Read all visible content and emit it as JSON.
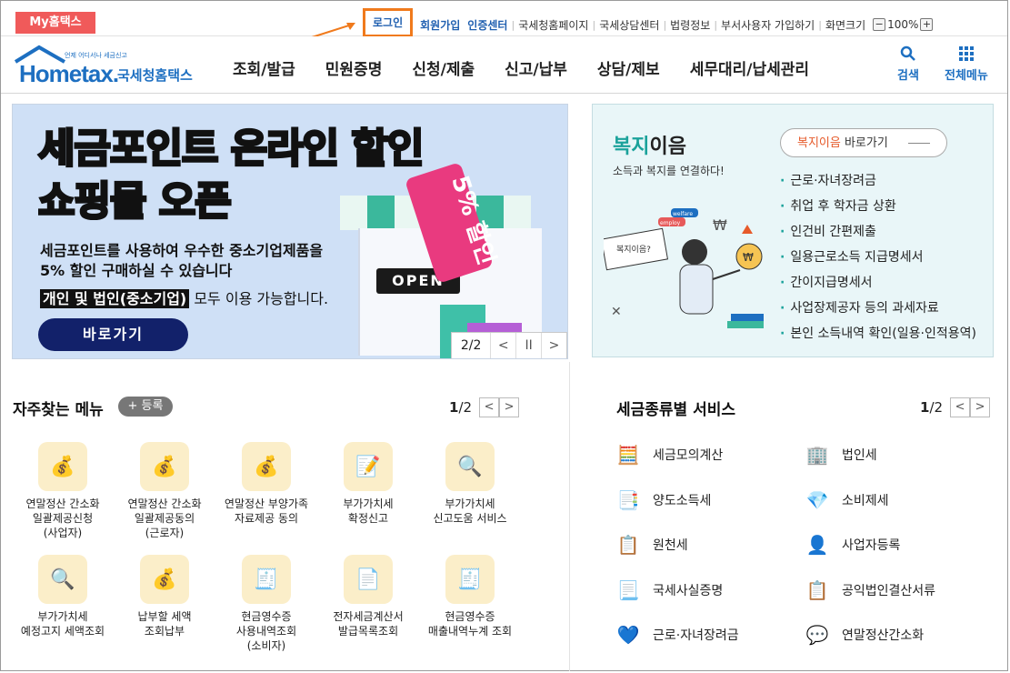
{
  "topbar": {
    "my_hometax": "My홈택스",
    "login": "로그인",
    "signup": "회원가입",
    "cert_center": "인증센터",
    "links": [
      "국세청홈페이지",
      "국세상담센터",
      "법령정보",
      "부서사용자 가입하기"
    ],
    "screen_size_label": "화면크기",
    "zoom_value": "100%",
    "zoom_out": "−",
    "zoom_in": "+"
  },
  "header": {
    "logo_main": "Hometax.",
    "logo_sub": "언제 어디서나 세금신고",
    "logo_kor": "국세청홈택스",
    "nav": [
      "조회/발급",
      "민원증명",
      "신청/제출",
      "신고/납부",
      "상담/제보",
      "세무대리/납세관리"
    ],
    "search_label": "검색",
    "all_menu_label": "전체메뉴"
  },
  "banner": {
    "title1": "세금포인트 온라인 할인",
    "title2": "쇼핑몰 오픈",
    "desc1": "세금포인트를 사용하여 우수한 중소기업제품을",
    "desc2": "5% 할인 구매하실 수 있습니다",
    "desc3_highlight": "개인 및 법인(중소기업)",
    "desc3_rest": " 모두 이용 가능합니다.",
    "button": "바로가기",
    "open_sign": "OPEN",
    "tag_text": "5% 할인",
    "pager": "2/2",
    "prev": "<",
    "pause": "II",
    "next": ">"
  },
  "welfare": {
    "title_green": "복지",
    "title_rest": "이음",
    "subtitle": "소득과 복지를 연결하다!",
    "button_highlight": "복지이음",
    "button_rest": " 바로가기",
    "items": [
      "근로·자녀장려금",
      "취업 후 학자금 상환",
      "인건비 간편제출",
      "일용근로소득 지급명세서",
      "간이지급명세서",
      "사업장제공자 등의 과세자료",
      "본인 소득내역 확인(일용·인적용역)"
    ],
    "illu_bubble": "복지이음?",
    "illu_speech1": "employ",
    "illu_speech2": "welfare"
  },
  "favorites": {
    "title": "자주찾는 메뉴",
    "register": "+ 등록",
    "page_current": "1",
    "page_total": "/2",
    "prev": "<",
    "next": ">",
    "items": [
      {
        "label1": "연말정산 간소화",
        "label2": "일괄제공신청",
        "label3": "(사업자)",
        "icon": "money-bag-icon"
      },
      {
        "label1": "연말정산 간소화",
        "label2": "일괄제공동의",
        "label3": "(근로자)",
        "icon": "money-bag-icon"
      },
      {
        "label1": "연말정산 부양가족",
        "label2": "자료제공 동의",
        "label3": "",
        "icon": "money-bag-icon"
      },
      {
        "label1": "부가가치세",
        "label2": "확정신고",
        "label3": "",
        "icon": "vat-icon"
      },
      {
        "label1": "부가가치세",
        "label2": "신고도움 서비스",
        "label3": "",
        "icon": "document-search-icon"
      },
      {
        "label1": "부가가치세",
        "label2": "예정고지 세액조회",
        "label3": "",
        "icon": "document-search-icon"
      },
      {
        "label1": "납부할 세액",
        "label2": "조회납부",
        "label3": "",
        "icon": "money-bag-icon"
      },
      {
        "label1": "현금영수증",
        "label2": "사용내역조회",
        "label3": "(소비자)",
        "icon": "receipt-search-icon"
      },
      {
        "label1": "전자세금계산서",
        "label2": "발급목록조회",
        "label3": "",
        "icon": "invoice-search-icon"
      },
      {
        "label1": "현금영수증",
        "label2": "매출내역누계 조회",
        "label3": "",
        "icon": "receipt-search-icon"
      }
    ]
  },
  "tax_services": {
    "title": "세금종류별 서비스",
    "page_current": "1",
    "page_total": "/2",
    "prev": "<",
    "next": ">",
    "items": [
      {
        "label": "세금모의계산",
        "icon": "calculator-icon"
      },
      {
        "label": "법인세",
        "icon": "building-icon"
      },
      {
        "label": "양도소득세",
        "icon": "transfer-document-icon"
      },
      {
        "label": "소비제세",
        "icon": "diamond-icon"
      },
      {
        "label": "원천세",
        "icon": "salary-document-icon"
      },
      {
        "label": "사업자등록",
        "icon": "person-icon"
      },
      {
        "label": "국세사실증명",
        "icon": "certificate-icon"
      },
      {
        "label": "공익법인결산서류",
        "icon": "clipboard-check-icon"
      },
      {
        "label": "근로·자녀장려금",
        "icon": "heart-hands-icon"
      },
      {
        "label": "연말정산간소화",
        "icon": "simplified-settlement-icon"
      }
    ]
  },
  "colors": {
    "brand_blue": "#1d6fc1",
    "login_highlight": "#f07a1c",
    "my_hometax": "#f05a5a",
    "welfare_green": "#1ba29b"
  }
}
